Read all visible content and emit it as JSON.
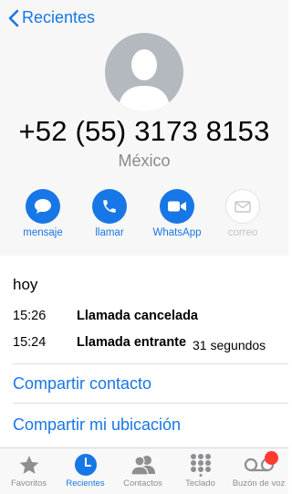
{
  "nav": {
    "back_label": "Recientes"
  },
  "contact": {
    "phone": "+52 (55) 3173 8153",
    "country": "México"
  },
  "actions": [
    {
      "label": "mensaje",
      "icon": "message-bubble-icon",
      "enabled": true
    },
    {
      "label": "llamar",
      "icon": "phone-icon",
      "enabled": true
    },
    {
      "label": "WhatsApp",
      "icon": "video-camera-icon",
      "enabled": true
    },
    {
      "label": "correo",
      "icon": "envelope-icon",
      "enabled": false
    }
  ],
  "calls": {
    "day": "hoy",
    "entries": [
      {
        "time": "15:26",
        "description": "Llamada cancelada",
        "duration": ""
      },
      {
        "time": "15:24",
        "description": "Llamada entrante",
        "duration": "31 segundos"
      }
    ]
  },
  "links": {
    "share_contact": "Compartir contacto",
    "share_location": "Compartir mi ubicación"
  },
  "tabs": [
    {
      "label": "Favoritos",
      "icon": "star-icon",
      "active": false
    },
    {
      "label": "Recientes",
      "icon": "clock-icon",
      "active": true
    },
    {
      "label": "Contactos",
      "icon": "contacts-icon",
      "active": false
    },
    {
      "label": "Teclado",
      "icon": "keypad-icon",
      "active": false
    },
    {
      "label": "Buzón de voz",
      "icon": "voicemail-icon",
      "active": false,
      "badge": true
    }
  ],
  "colors": {
    "accent": "#1877e6",
    "badge": "#ff3b30",
    "secondary_text": "#8a8a8e"
  }
}
